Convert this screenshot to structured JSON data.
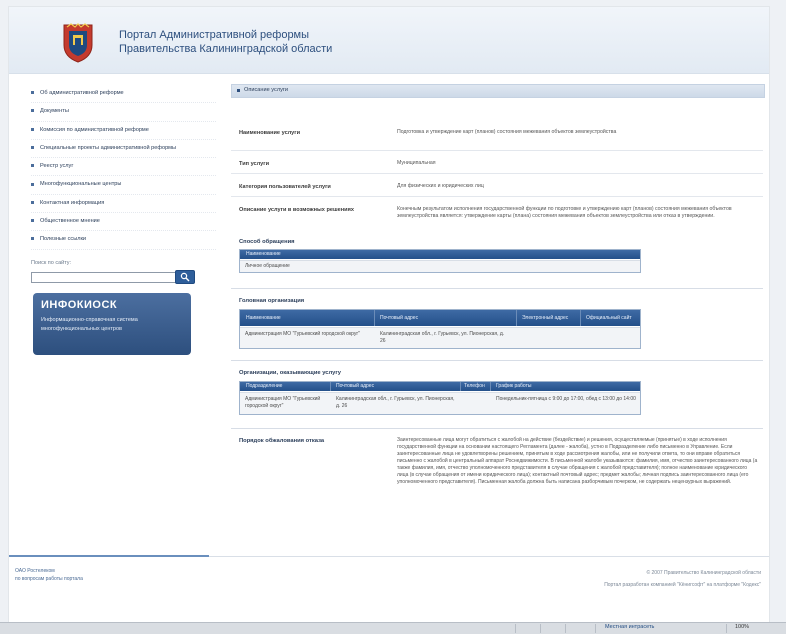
{
  "header": {
    "title": "Портал Административной реформы",
    "subtitle": "Правительства Калининградской области"
  },
  "nav": {
    "items": [
      {
        "label": "Об административной реформе"
      },
      {
        "label": "Документы"
      },
      {
        "label": "Комиссия по административной реформе"
      },
      {
        "label": "Специальные проекты административной реформы"
      },
      {
        "label": "Реестр услуг"
      },
      {
        "label": "Многофункциональные центры"
      },
      {
        "label": "Контактная информация"
      },
      {
        "label": "Общественное мнение"
      },
      {
        "label": "Полезные ссылки"
      }
    ],
    "search_label": "Поиск по сайту:",
    "search_value": ""
  },
  "kiosk": {
    "title": "ИНФОКИОСК",
    "text": "Информационно-справочная система многофункциональных центров"
  },
  "breadcrumb": "Описание услуги",
  "service": {
    "rows": [
      {
        "key": "Наименование услуги",
        "value": "Подготовка и утверждение карт (планов) состояния межевания объектов землеустройства"
      },
      {
        "key": "Тип услуги",
        "value": "Муниципальная"
      },
      {
        "key": "Категория пользователей услуги",
        "value": "Для физических и юридических лиц"
      },
      {
        "key": "Описание услуги в возможных решениях",
        "value": "Конечным результатом исполнения государственной функции по подготовке и утверждению карт (планов) состояния межевания объектов землеустройства является: утверждение карты (плана) состояния межевания объектов землеустройства или отказ в утверждении."
      }
    ]
  },
  "appeal": {
    "title": "Способ обращения",
    "header": "Наименование",
    "rows": [
      "Личное обращение"
    ]
  },
  "lead_org": {
    "title": "Головная организация",
    "columns": [
      "Наименование",
      "Почтовый адрес",
      "Электронный адрес",
      "Официальный сайт"
    ],
    "rows": [
      [
        "Администрация МО \"Гурьевский городской округ\"",
        "Калининградская обл., г. Гурьевск, ул. Пионерская, д. 26",
        "",
        ""
      ]
    ]
  },
  "providers": {
    "title": "Организации, оказывающие услугу",
    "columns": [
      "Подразделение",
      "Почтовый адрес",
      "Телефон",
      "График работы"
    ],
    "rows": [
      [
        "Администрация МО \"Гурьевский городской округ\"",
        "Калининградская обл., г. Гурьевск, ул. Пионерская, д. 26",
        "",
        "Понедельник-пятница с 9:00 до 17:00, обед с 13:00 до 14:00"
      ]
    ]
  },
  "appeal_order": {
    "title": "Порядок обжалования отказа",
    "text": "Заинтересованные лица могут обратиться с жалобой на действие (бездействие) и решения, осуществляемые (принятые) в ходе исполнения государственной функции на основании настоящего Регламента (далее - жалоба), устно в Подразделение либо письменно в Управление. Если заинтересованные лица не удовлетворены решением, принятым в ходе рассмотрения жалобы, или не получили ответа, то они вправе обратиться письменно с жалобой в центральный аппарат Роснедвижимости. В письменной жалобе указываются: фамилия, имя, отчество заинтересованного лица (а также фамилия, имя, отчество уполномоченного представителя в случае обращения с жалобой представителя); полное наименование юридического лица (в случае обращения от имени юридического лица); контактный почтовый адрес; предмет жалобы; личная подпись заинтересованного лица (его уполномоченного представителя). Письменная жалоба должна быть написана разборчивым почерком, не содержать нецензурных выражений."
  },
  "footer": {
    "left_line1": "ОАО Ростелеком",
    "left_line2": "по вопросам работы портала",
    "copyright": "© 2007 Правительство Калининградской области",
    "credits": "Портал разработан компанией \"Кёнигсофт\" на платформе \"Кодекс\""
  },
  "statusbar": {
    "zone": "Местная интрасеть",
    "zoom": "100%"
  },
  "colors": {
    "brand": "#2d4f7e",
    "grid_header": "#24508a"
  }
}
